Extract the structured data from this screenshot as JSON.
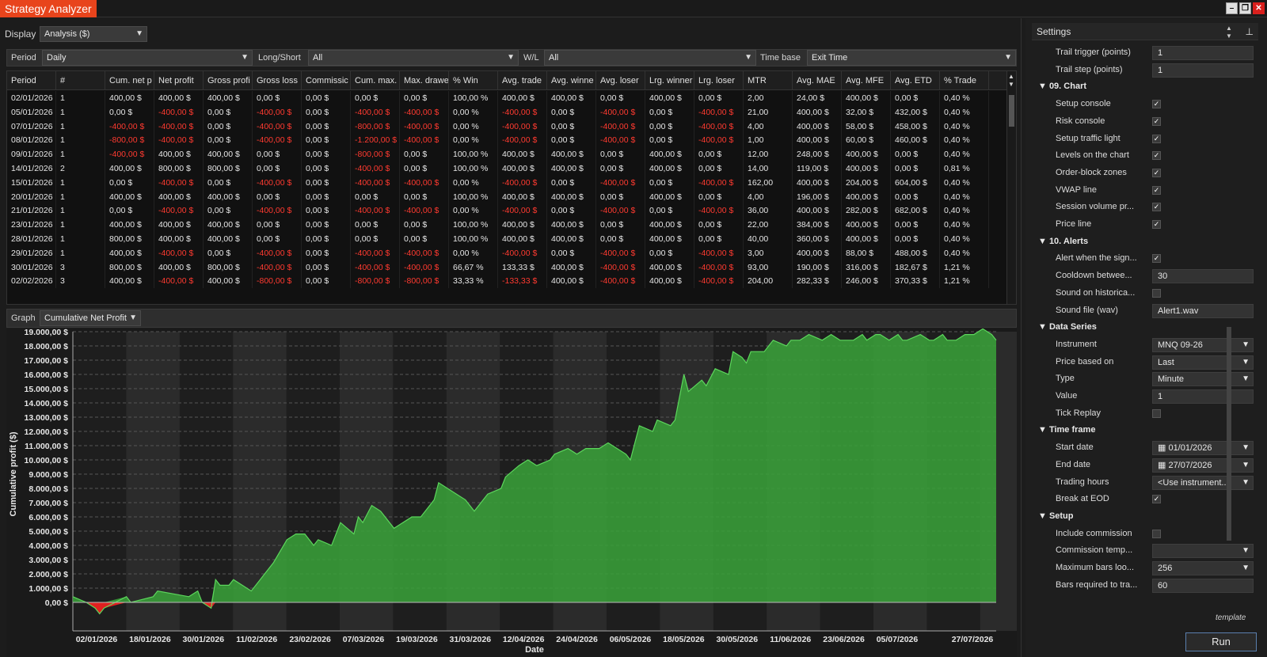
{
  "window": {
    "title": "Strategy Analyzer"
  },
  "display": {
    "label": "Display",
    "value": "Analysis ($)"
  },
  "filters": {
    "period_label": "Period",
    "period_value": "Daily",
    "longshort_label": "Long/Short",
    "longshort_value": "All",
    "wl_label": "W/L",
    "wl_value": "All",
    "timebase_label": "Time base",
    "timebase_value": "Exit Time"
  },
  "table": {
    "headers": [
      "Period",
      "#",
      "Cum. net p",
      "Net profit",
      "Gross profi",
      "Gross loss",
      "Commissic",
      "Cum. max.",
      "Max. drawe",
      "% Win",
      "Avg. trade",
      "Avg. winne",
      "Avg. loser",
      "Lrg. winner",
      "Lrg. loser",
      "MTR",
      "Avg. MAE",
      "Avg. MFE",
      "Avg. ETD",
      "% Trade"
    ],
    "rows": [
      [
        "02/01/2026",
        "1",
        "400,00 $",
        "400,00 $",
        "400,00 $",
        "0,00 $",
        "0,00 $",
        "0,00 $",
        "0,00 $",
        "100,00 %",
        "400,00 $",
        "400,00 $",
        "0,00 $",
        "400,00 $",
        "0,00 $",
        "2,00",
        "24,00 $",
        "400,00 $",
        "0,00 $",
        "0,40 %"
      ],
      [
        "05/01/2026",
        "1",
        "0,00 $",
        "-400,00 $",
        "0,00 $",
        "-400,00 $",
        "0,00 $",
        "-400,00 $",
        "-400,00 $",
        "0,00 %",
        "-400,00 $",
        "0,00 $",
        "-400,00 $",
        "0,00 $",
        "-400,00 $",
        "21,00",
        "400,00 $",
        "32,00 $",
        "432,00 $",
        "0,40 %"
      ],
      [
        "07/01/2026",
        "1",
        "-400,00 $",
        "-400,00 $",
        "0,00 $",
        "-400,00 $",
        "0,00 $",
        "-800,00 $",
        "-400,00 $",
        "0,00 %",
        "-400,00 $",
        "0,00 $",
        "-400,00 $",
        "0,00 $",
        "-400,00 $",
        "4,00",
        "400,00 $",
        "58,00 $",
        "458,00 $",
        "0,40 %"
      ],
      [
        "08/01/2026",
        "1",
        "-800,00 $",
        "-400,00 $",
        "0,00 $",
        "-400,00 $",
        "0,00 $",
        "-1.200,00 $",
        "-400,00 $",
        "0,00 %",
        "-400,00 $",
        "0,00 $",
        "-400,00 $",
        "0,00 $",
        "-400,00 $",
        "1,00",
        "400,00 $",
        "60,00 $",
        "460,00 $",
        "0,40 %"
      ],
      [
        "09/01/2026",
        "1",
        "-400,00 $",
        "400,00 $",
        "400,00 $",
        "0,00 $",
        "0,00 $",
        "-800,00 $",
        "0,00 $",
        "100,00 %",
        "400,00 $",
        "400,00 $",
        "0,00 $",
        "400,00 $",
        "0,00 $",
        "12,00",
        "248,00 $",
        "400,00 $",
        "0,00 $",
        "0,40 %"
      ],
      [
        "14/01/2026",
        "2",
        "400,00 $",
        "800,00 $",
        "800,00 $",
        "0,00 $",
        "0,00 $",
        "-400,00 $",
        "0,00 $",
        "100,00 %",
        "400,00 $",
        "400,00 $",
        "0,00 $",
        "400,00 $",
        "0,00 $",
        "14,00",
        "119,00 $",
        "400,00 $",
        "0,00 $",
        "0,81 %"
      ],
      [
        "15/01/2026",
        "1",
        "0,00 $",
        "-400,00 $",
        "0,00 $",
        "-400,00 $",
        "0,00 $",
        "-400,00 $",
        "-400,00 $",
        "0,00 %",
        "-400,00 $",
        "0,00 $",
        "-400,00 $",
        "0,00 $",
        "-400,00 $",
        "162,00",
        "400,00 $",
        "204,00 $",
        "604,00 $",
        "0,40 %"
      ],
      [
        "20/01/2026",
        "1",
        "400,00 $",
        "400,00 $",
        "400,00 $",
        "0,00 $",
        "0,00 $",
        "0,00 $",
        "0,00 $",
        "100,00 %",
        "400,00 $",
        "400,00 $",
        "0,00 $",
        "400,00 $",
        "0,00 $",
        "4,00",
        "196,00 $",
        "400,00 $",
        "0,00 $",
        "0,40 %"
      ],
      [
        "21/01/2026",
        "1",
        "0,00 $",
        "-400,00 $",
        "0,00 $",
        "-400,00 $",
        "0,00 $",
        "-400,00 $",
        "-400,00 $",
        "0,00 %",
        "-400,00 $",
        "0,00 $",
        "-400,00 $",
        "0,00 $",
        "-400,00 $",
        "36,00",
        "400,00 $",
        "282,00 $",
        "682,00 $",
        "0,40 %"
      ],
      [
        "23/01/2026",
        "1",
        "400,00 $",
        "400,00 $",
        "400,00 $",
        "0,00 $",
        "0,00 $",
        "0,00 $",
        "0,00 $",
        "100,00 %",
        "400,00 $",
        "400,00 $",
        "0,00 $",
        "400,00 $",
        "0,00 $",
        "22,00",
        "384,00 $",
        "400,00 $",
        "0,00 $",
        "0,40 %"
      ],
      [
        "28/01/2026",
        "1",
        "800,00 $",
        "400,00 $",
        "400,00 $",
        "0,00 $",
        "0,00 $",
        "0,00 $",
        "0,00 $",
        "100,00 %",
        "400,00 $",
        "400,00 $",
        "0,00 $",
        "400,00 $",
        "0,00 $",
        "40,00",
        "360,00 $",
        "400,00 $",
        "0,00 $",
        "0,40 %"
      ],
      [
        "29/01/2026",
        "1",
        "400,00 $",
        "-400,00 $",
        "0,00 $",
        "-400,00 $",
        "0,00 $",
        "-400,00 $",
        "-400,00 $",
        "0,00 %",
        "-400,00 $",
        "0,00 $",
        "-400,00 $",
        "0,00 $",
        "-400,00 $",
        "3,00",
        "400,00 $",
        "88,00 $",
        "488,00 $",
        "0,40 %"
      ],
      [
        "30/01/2026",
        "3",
        "800,00 $",
        "400,00 $",
        "800,00 $",
        "-400,00 $",
        "0,00 $",
        "-400,00 $",
        "-400,00 $",
        "66,67 %",
        "133,33 $",
        "400,00 $",
        "-400,00 $",
        "400,00 $",
        "-400,00 $",
        "93,00",
        "190,00 $",
        "316,00 $",
        "182,67 $",
        "1,21 %"
      ],
      [
        "02/02/2026",
        "3",
        "400,00 $",
        "-400,00 $",
        "400,00 $",
        "-800,00 $",
        "0,00 $",
        "-800,00 $",
        "-800,00 $",
        "33,33 %",
        "-133,33 $",
        "400,00 $",
        "-400,00 $",
        "400,00 $",
        "-400,00 $",
        "204,00",
        "282,33 $",
        "246,00 $",
        "370,33 $",
        "1,21 %"
      ]
    ]
  },
  "graph": {
    "label": "Graph",
    "value": "Cumulative Net Profit"
  },
  "chart_data": {
    "type": "area",
    "xlabel": "Date",
    "ylabel": "Cumulative profit ($)",
    "ylim": [
      -1000,
      19000
    ],
    "ytick_labels": [
      "0,00 $",
      "1.000,00 $",
      "2.000,00 $",
      "3.000,00 $",
      "4.000,00 $",
      "5.000,00 $",
      "6.000,00 $",
      "7.000,00 $",
      "8.000,00 $",
      "9.000,00 $",
      "10.000,00 $",
      "11.000,00 $",
      "12.000,00 $",
      "13.000,00 $",
      "14.000,00 $",
      "15.000,00 $",
      "16.000,00 $",
      "17.000,00 $",
      "18.000,00 $",
      "19.000,00 $"
    ],
    "xtick_labels": [
      "02/01/2026",
      "18/01/2026",
      "30/01/2026",
      "11/02/2026",
      "23/02/2026",
      "07/03/2026",
      "19/03/2026",
      "31/03/2026",
      "12/04/2026",
      "24/04/2026",
      "06/05/2026",
      "18/05/2026",
      "30/05/2026",
      "11/06/2026",
      "23/06/2026",
      "05/07/2026",
      "27/07/2026"
    ],
    "x_days": [
      0,
      3,
      5,
      6,
      7,
      12,
      13,
      18,
      19,
      26,
      28,
      29,
      31,
      32,
      33,
      35,
      36,
      40,
      42,
      43,
      45,
      48,
      50,
      52,
      54,
      55,
      58,
      60,
      63,
      64,
      65,
      67,
      69,
      70,
      72,
      76,
      78,
      81,
      82,
      86,
      88,
      90,
      92,
      93,
      96,
      97,
      100,
      102,
      104,
      107,
      108,
      111,
      113,
      115,
      117,
      118,
      120,
      124,
      125,
      127,
      130,
      131,
      134,
      135,
      137,
      138,
      141,
      142,
      144,
      147,
      148,
      150,
      151,
      152,
      155,
      156,
      157,
      160,
      161,
      163,
      165,
      168,
      170,
      172,
      175,
      177,
      178,
      180,
      181,
      183,
      185,
      186,
      187,
      190,
      192,
      193,
      195,
      196,
      198,
      200,
      202,
      204,
      206,
      207
    ],
    "values": [
      400,
      0,
      -400,
      -800,
      -400,
      400,
      0,
      400,
      800,
      400,
      800,
      0,
      -400,
      1600,
      1200,
      1200,
      1600,
      800,
      1600,
      2000,
      2800,
      4400,
      4800,
      4800,
      4000,
      4400,
      4000,
      5600,
      4800,
      6000,
      5600,
      6800,
      6400,
      6000,
      5200,
      6000,
      6000,
      7200,
      8400,
      7600,
      7200,
      6400,
      7200,
      7600,
      8000,
      8800,
      9600,
      10000,
      9600,
      10000,
      10400,
      10800,
      10400,
      10800,
      10800,
      10800,
      11200,
      10400,
      10000,
      12400,
      12000,
      12800,
      12400,
      12800,
      16000,
      14800,
      15600,
      15200,
      16400,
      16000,
      17600,
      17200,
      16800,
      17600,
      17600,
      18000,
      18400,
      18000,
      18400,
      18400,
      18800,
      18400,
      18800,
      18400,
      18400,
      18800,
      18400,
      18800,
      18800,
      18400,
      18800,
      18400,
      18400,
      18800,
      18400,
      18400,
      18800,
      18400,
      18400,
      18800,
      18800,
      19200,
      18800,
      18400
    ],
    "colors": {
      "fill": "#3aa33a",
      "line": "#5cd65c",
      "negative": "#e02020"
    }
  },
  "settings": {
    "title": "Settings",
    "rows": [
      {
        "kind": "field",
        "label": "Trail trigger (points)",
        "value": "1"
      },
      {
        "kind": "field",
        "label": "Trail step (points)",
        "value": "1"
      },
      {
        "kind": "section",
        "label": "09. Chart"
      },
      {
        "kind": "check",
        "label": "Setup console",
        "checked": true
      },
      {
        "kind": "check",
        "label": "Risk console",
        "checked": true
      },
      {
        "kind": "check",
        "label": "Setup traffic light",
        "checked": true
      },
      {
        "kind": "check",
        "label": "Levels on the chart",
        "checked": true
      },
      {
        "kind": "check",
        "label": "Order-block zones",
        "checked": true
      },
      {
        "kind": "check",
        "label": "VWAP line",
        "checked": true
      },
      {
        "kind": "check",
        "label": "Session volume pr...",
        "checked": true
      },
      {
        "kind": "check",
        "label": "Price line",
        "checked": true
      },
      {
        "kind": "section",
        "label": "10. Alerts"
      },
      {
        "kind": "check",
        "label": "Alert when the sign...",
        "checked": true
      },
      {
        "kind": "field",
        "label": "Cooldown betwee...",
        "value": "30"
      },
      {
        "kind": "check",
        "label": "Sound on historica...",
        "checked": false
      },
      {
        "kind": "field",
        "label": "Sound file (wav)",
        "value": "Alert1.wav"
      },
      {
        "kind": "section",
        "label": "Data Series"
      },
      {
        "kind": "select",
        "label": "Instrument",
        "value": "MNQ 09-26"
      },
      {
        "kind": "select",
        "label": "Price based on",
        "value": "Last"
      },
      {
        "kind": "select",
        "label": "Type",
        "value": "Minute"
      },
      {
        "kind": "field",
        "label": "Value",
        "value": "1"
      },
      {
        "kind": "check",
        "label": "Tick Replay",
        "checked": false
      },
      {
        "kind": "section",
        "label": "Time frame"
      },
      {
        "kind": "date",
        "label": "Start date",
        "value": "01/01/2026"
      },
      {
        "kind": "date",
        "label": "End date",
        "value": "27/07/2026"
      },
      {
        "kind": "select",
        "label": "Trading hours",
        "value": "<Use instrument..."
      },
      {
        "kind": "check",
        "label": "Break at EOD",
        "checked": true
      },
      {
        "kind": "section",
        "label": "Setup"
      },
      {
        "kind": "check",
        "label": "Include commission",
        "checked": false
      },
      {
        "kind": "select",
        "label": "Commission temp...",
        "value": ""
      },
      {
        "kind": "select",
        "label": "Maximum bars loo...",
        "value": "256"
      },
      {
        "kind": "field",
        "label": "Bars required to tra...",
        "value": "60"
      }
    ],
    "template_label": "template",
    "run_label": "Run"
  }
}
